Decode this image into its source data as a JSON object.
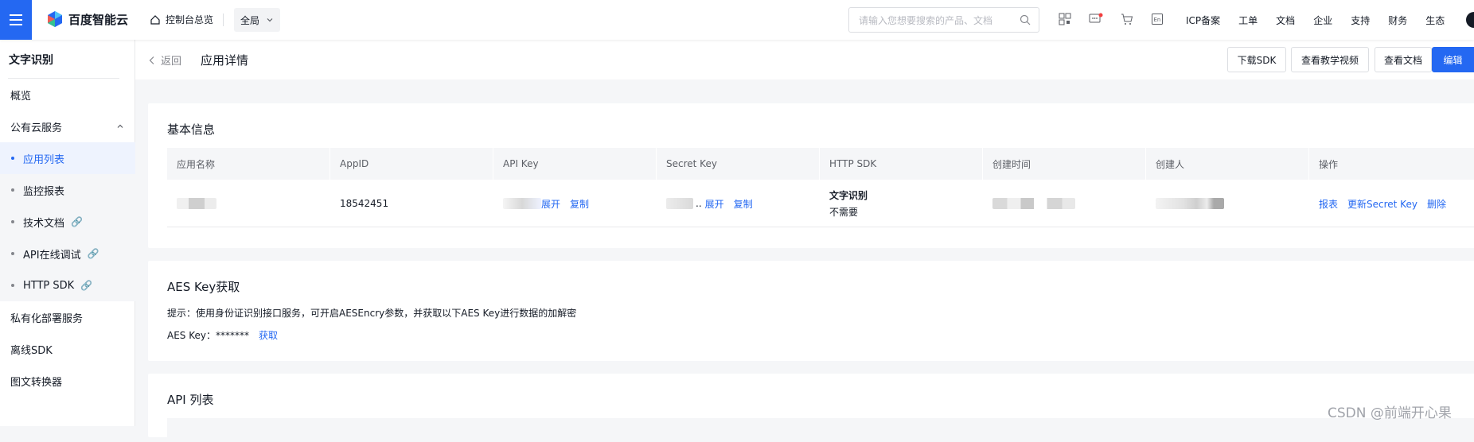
{
  "topbar": {
    "logo_text": "百度智能云",
    "home_label": "控制台总览",
    "region_label": "全局",
    "search_placeholder": "请输入您想要搜索的产品、文档",
    "links": [
      "ICP备案",
      "工单",
      "文档",
      "企业",
      "支持",
      "财务",
      "生态"
    ],
    "icons": [
      "qrcode-icon",
      "message-icon",
      "cart-icon",
      "language-icon"
    ],
    "accent": "#2468f2"
  },
  "sidebar": {
    "title": "文字识别",
    "items": [
      {
        "label": "概览"
      },
      {
        "label": "公有云服务"
      },
      {
        "label": "应用列表"
      },
      {
        "label": "监控报表"
      },
      {
        "label": "技术文档"
      },
      {
        "label": "API在线调试"
      },
      {
        "label": "HTTP SDK"
      },
      {
        "label": "私有化部署服务"
      },
      {
        "label": "离线SDK"
      },
      {
        "label": "图文转换器"
      }
    ]
  },
  "header": {
    "back_label": "返回",
    "title": "应用详情",
    "buttons": [
      "下载SDK",
      "查看教学视频",
      "查看文档",
      "编辑"
    ]
  },
  "basic": {
    "title": "基本信息",
    "columns": [
      "应用名称",
      "AppID",
      "API Key",
      "Secret Key",
      "HTTP SDK",
      "创建时间",
      "创建人",
      "操作"
    ],
    "row": {
      "appid": "18542451",
      "expand": "展开",
      "copy": "复制",
      "secret_prefix": "..",
      "sdk_line1": "文字识别",
      "sdk_line2": "不需要",
      "actions": [
        "报表",
        "更新Secret Key",
        "删除"
      ]
    }
  },
  "aes": {
    "title": "AES Key获取",
    "hint": "提示：使用身份证识别接口服务，可开启AESEncry参数，并获取以下AES Key进行数据的加解密",
    "key_label": "AES Key：*******",
    "fetch_label": "获取"
  },
  "api": {
    "title": "API 列表"
  },
  "watermark": "CSDN @前端开心果"
}
